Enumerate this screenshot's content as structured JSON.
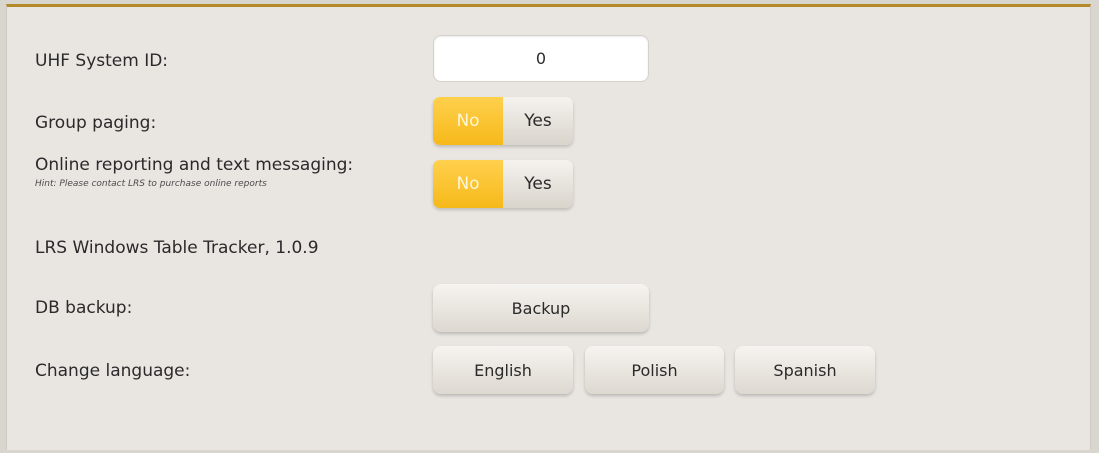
{
  "settings": {
    "uhf_system_id": {
      "label": "UHF System ID:",
      "value": "0"
    },
    "group_paging": {
      "label": "Group paging:",
      "options": {
        "no": "No",
        "yes": "Yes"
      },
      "selected": "No"
    },
    "online_reporting": {
      "label": "Online reporting and text messaging:",
      "hint": "Hint: Please contact LRS to purchase online reports",
      "options": {
        "no": "No",
        "yes": "Yes"
      },
      "selected": "No"
    },
    "version_text": "LRS Windows Table Tracker, 1.0.9",
    "db_backup": {
      "label": "DB backup:",
      "button": "Backup"
    },
    "change_language": {
      "label": "Change language:",
      "buttons": {
        "english": "English",
        "polish": "Polish",
        "spanish": "Spanish"
      }
    }
  },
  "colors": {
    "accent_yellow": "#f6b91a",
    "panel_bg": "#e9e6e2",
    "top_border": "#b58a2a"
  }
}
